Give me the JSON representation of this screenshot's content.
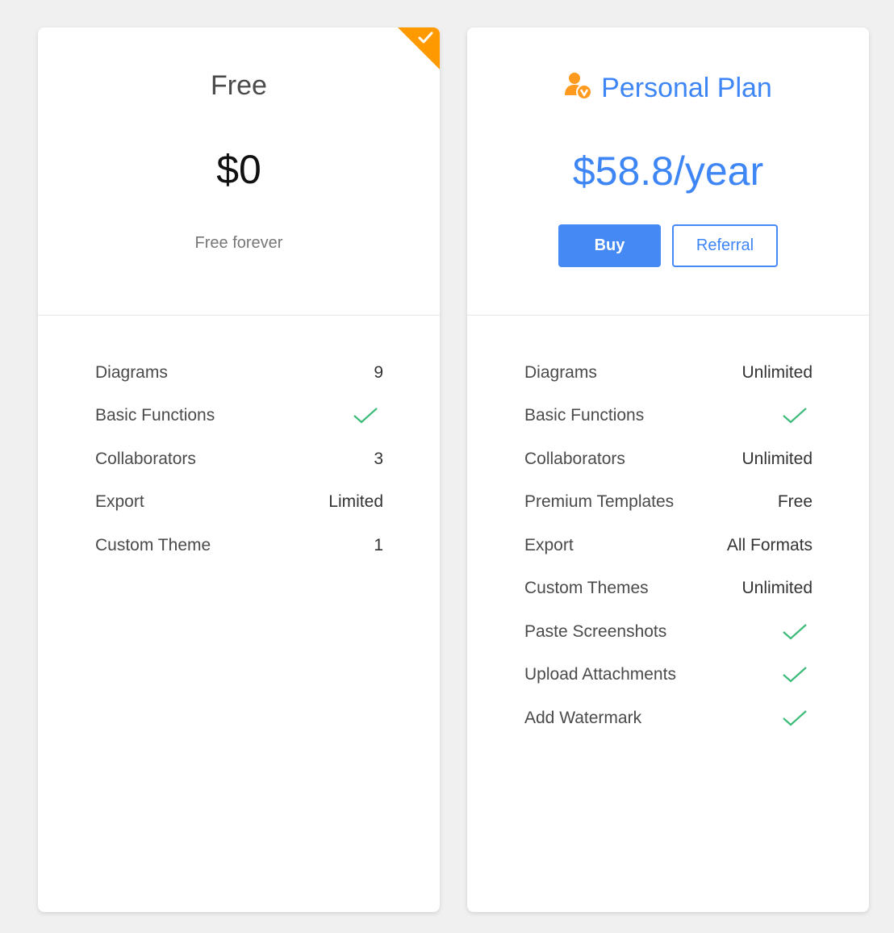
{
  "colors": {
    "accent": "#3e86f5",
    "badge": "#ff9900",
    "check": "#3dbb7a"
  },
  "free_plan": {
    "title": "Free",
    "price": "$0",
    "subtitle": "Free forever",
    "selected_badge_icon": "check-icon",
    "features": [
      {
        "label": "Diagrams",
        "value": "9",
        "check": false
      },
      {
        "label": "Basic Functions",
        "value": "",
        "check": true
      },
      {
        "label": "Collaborators",
        "value": "3",
        "check": false
      },
      {
        "label": "Export",
        "value": "Limited",
        "check": false
      },
      {
        "label": "Custom Theme",
        "value": "1",
        "check": false
      }
    ]
  },
  "personal_plan": {
    "icon": "user-vip-icon",
    "title": "Personal Plan",
    "price": "$58.8/year",
    "buy_label": "Buy",
    "referral_label": "Referral",
    "features": [
      {
        "label": "Diagrams",
        "value": "Unlimited",
        "check": false
      },
      {
        "label": "Basic Functions",
        "value": "",
        "check": true
      },
      {
        "label": "Collaborators",
        "value": "Unlimited",
        "check": false
      },
      {
        "label": "Premium Templates",
        "value": "Free",
        "check": false
      },
      {
        "label": "Export",
        "value": "All Formats",
        "check": false
      },
      {
        "label": "Custom Themes",
        "value": "Unlimited",
        "check": false
      },
      {
        "label": "Paste Screenshots",
        "value": "",
        "check": true
      },
      {
        "label": "Upload Attachments",
        "value": "",
        "check": true
      },
      {
        "label": "Add Watermark",
        "value": "",
        "check": true
      }
    ]
  }
}
